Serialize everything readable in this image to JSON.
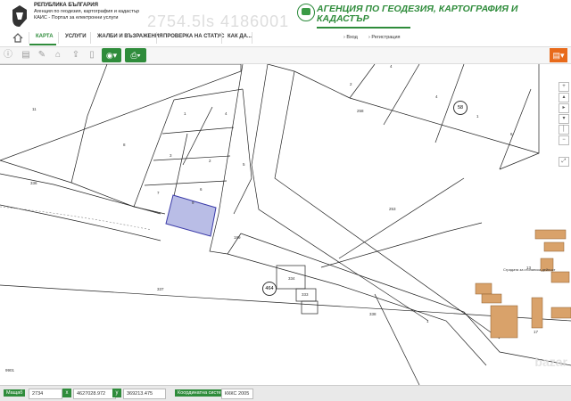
{
  "header": {
    "country": "РЕПУБЛИКА БЪЛГАРИЯ",
    "agency_line": "Агенция по геодезия, картография и кадастър",
    "system_line": "КАИС - Портал за електронни услуги",
    "watermark": "2754.5ls 4186001",
    "agency_title": "АГЕНЦИЯ ПО ГЕОДЕЗИЯ, КАРТОГРАФИЯ И КАДАСТЪР"
  },
  "nav": {
    "items": [
      "КАРТА",
      "УСЛУГИ",
      "ЖАЛБИ И ВЪЗРАЖЕНИЯ",
      "ПРОВЕРКА НА СТАТУС",
      "КАК ДА..."
    ],
    "login": "› Вход",
    "register": "› Регистрация"
  },
  "map": {
    "parcel_labels": [
      "1",
      "4",
      "3",
      "2",
      "7",
      "6",
      "5",
      "8",
      "9",
      "11",
      "10",
      "336",
      "189",
      "253",
      "4",
      "4",
      "6",
      "2",
      "1",
      "258",
      "334",
      "333",
      "337",
      "13",
      "17",
      "1",
      "338",
      "9901"
    ],
    "circle_labels": [
      "58",
      "464"
    ],
    "building_label": "Сградата за стопанска дейност"
  },
  "status": {
    "zoom_label": "Мащаб",
    "zoom_value": "2734",
    "x_value": "4627028.972",
    "y_value": "369213.475",
    "coord_label": "Координатна система",
    "coord_value": "КККС 2005"
  },
  "overlay": {
    "bazar": "bazar"
  },
  "colors": {
    "brand_green": "#2f8c3b",
    "orange": "#e86a1a",
    "selected_parcel": "#b9bde6"
  }
}
